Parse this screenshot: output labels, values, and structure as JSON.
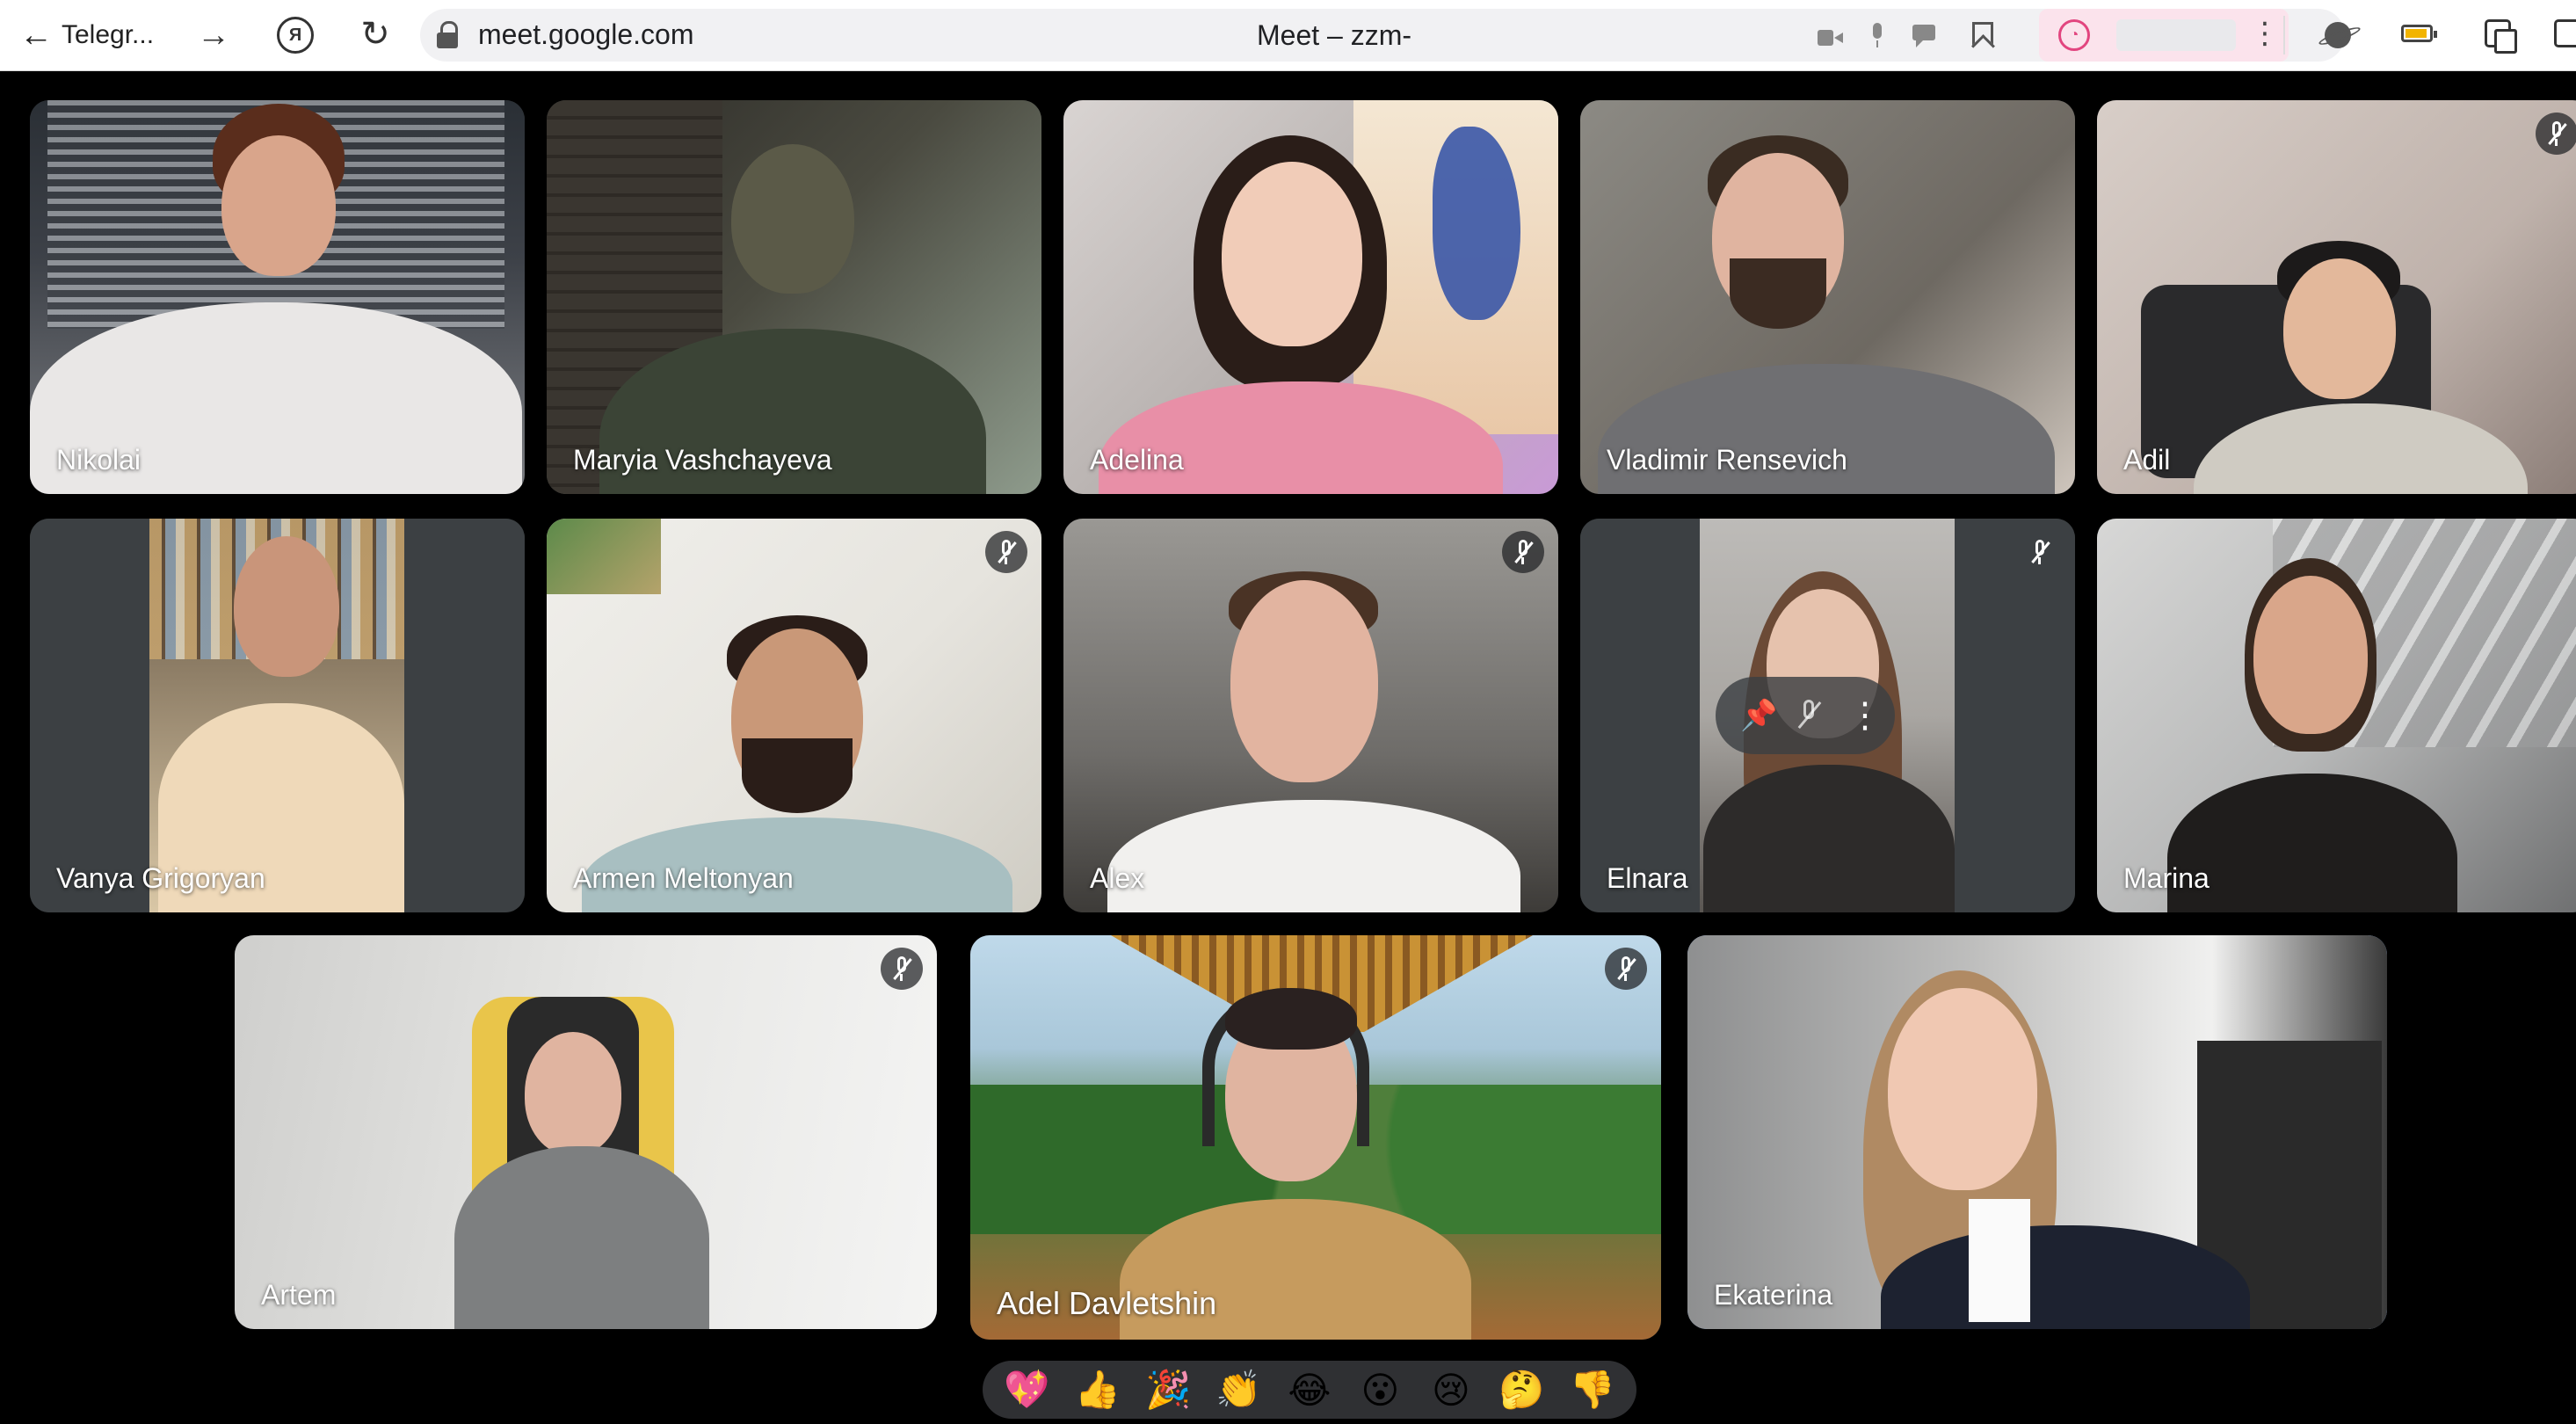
{
  "browser": {
    "back_label": "Telegr...",
    "back_glyph": "←",
    "forward_glyph": "→",
    "reload_glyph": "↻",
    "yandex_glyph": "Я",
    "url": "meet.google.com",
    "page_title": "Meet – zzm-"
  },
  "participants": [
    {
      "name": "Nikolai",
      "muted": false
    },
    {
      "name": "Maryia Vashchayeva",
      "muted": false
    },
    {
      "name": "Adelina",
      "muted": false
    },
    {
      "name": "Vladimir Rensevich",
      "muted": false
    },
    {
      "name": "Adil",
      "muted": true
    },
    {
      "name": "Vanya Grigoryan",
      "muted": false
    },
    {
      "name": "Armen Meltonyan",
      "muted": true
    },
    {
      "name": "Alex",
      "muted": true
    },
    {
      "name": "Elnara",
      "muted": true
    },
    {
      "name": "Marina",
      "muted": false
    },
    {
      "name": "Artem",
      "muted": true
    },
    {
      "name": "Adel Davletshin",
      "muted": true
    },
    {
      "name": "Ekaterina",
      "muted": false,
      "speaking": true
    }
  ],
  "tile_controls": {
    "pin_glyph": "📌",
    "more_glyph": "⋮"
  },
  "reactions": [
    "💖",
    "👍",
    "🎉",
    "👏",
    "😂",
    "😮",
    "😢",
    "🤔",
    "👎"
  ],
  "colors": {
    "speaking_border": "#8ab4f8",
    "tile_fallback": "#3c4043",
    "reaction_bar": "#2f3033"
  }
}
